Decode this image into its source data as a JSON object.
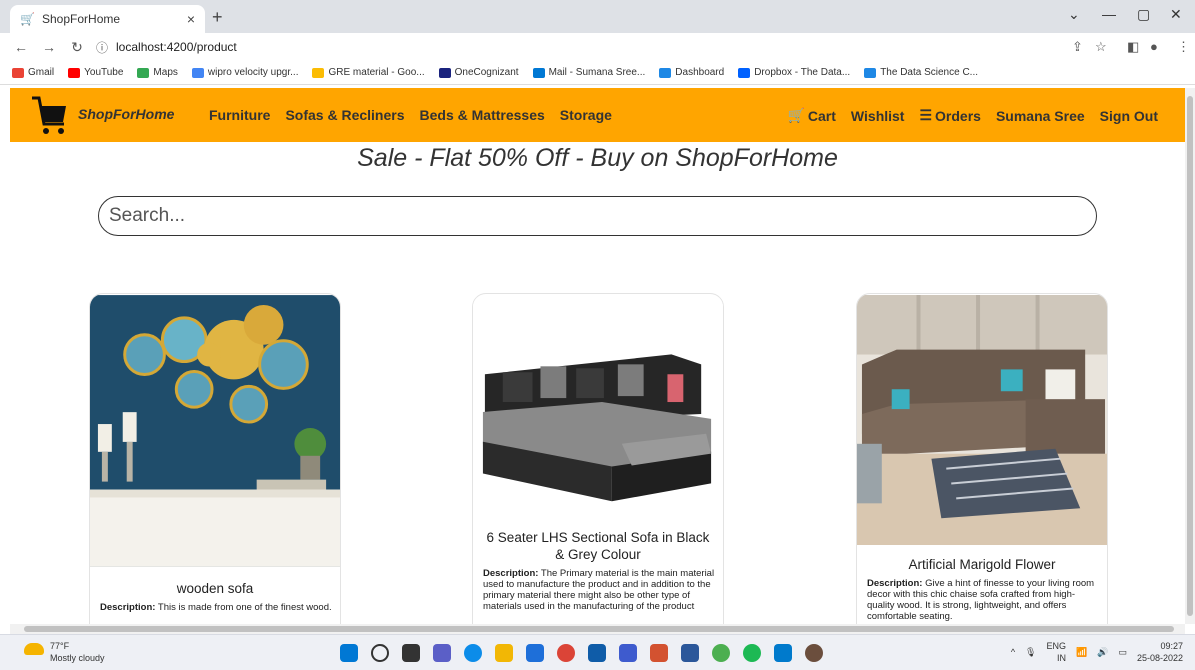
{
  "browser": {
    "tab_title": "ShopForHome",
    "tab_close": "×",
    "new_tab": "+",
    "url": "localhost:4200/product",
    "bookmarks": [
      {
        "label": "Gmail",
        "color": "#ea4335"
      },
      {
        "label": "YouTube",
        "color": "#ff0000"
      },
      {
        "label": "Maps",
        "color": "#34a853"
      },
      {
        "label": "wipro velocity upgr...",
        "color": "#4285f4"
      },
      {
        "label": "GRE material - Goo...",
        "color": "#fbbc04"
      },
      {
        "label": "OneCognizant",
        "color": "#1a237e"
      },
      {
        "label": "Mail - Sumana Sree...",
        "color": "#0078d4"
      },
      {
        "label": "Dashboard",
        "color": "#1e88e5"
      },
      {
        "label": "Dropbox - The Data...",
        "color": "#0061ff"
      },
      {
        "label": "The Data Science C...",
        "color": "#1e88e5"
      }
    ]
  },
  "navbar": {
    "brand": "ShopForHome",
    "links": [
      "Furniture",
      "Sofas & Recliners",
      "Beds & Mattresses",
      "Storage"
    ],
    "cart": "Cart",
    "wishlist": "Wishlist",
    "orders": "Orders",
    "user": "Sumana Sree",
    "signout": "Sign Out",
    "accent_color": "#ffa500"
  },
  "banner": {
    "text": "Sale - Flat 50% Off - Buy on ShopForHome"
  },
  "search": {
    "placeholder": "Search..."
  },
  "products": [
    {
      "title": "wooden sofa",
      "desc_label": "Description:",
      "desc": "This is made from one of the finest wood."
    },
    {
      "title": "6 Seater LHS Sectional Sofa in Black & Grey Colour",
      "desc_label": "Description:",
      "desc": "The Primary material is the main material used to manufacture the product and in addition to the primary material there might also be other type of materials used in the manufacturing of the product"
    },
    {
      "title": "Artificial Marigold Flower",
      "desc_label": "Description:",
      "desc": "Give a hint of finesse to your living room decor with this chic chaise sofa crafted from high-quality wood. It is strong, lightweight, and offers comfortable seating."
    }
  ],
  "taskbar": {
    "temp": "77°F",
    "weather": "Mostly cloudy",
    "lang1": "ENG",
    "lang2": "IN",
    "time": "09:27",
    "date": "25-08-2022"
  }
}
